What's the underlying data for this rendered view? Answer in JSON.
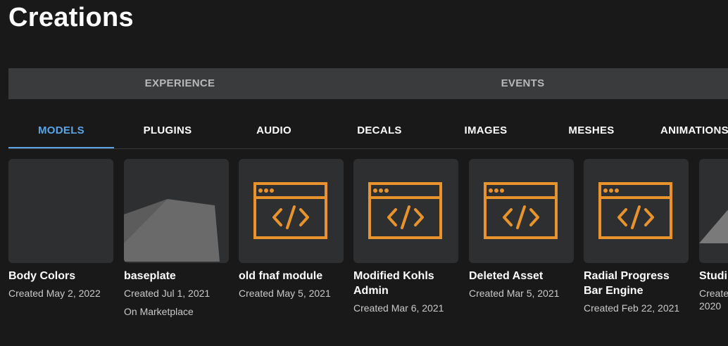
{
  "page": {
    "title": "Creations"
  },
  "primary_tabs": [
    {
      "label": "EXPERIENCE"
    },
    {
      "label": "EVENTS"
    }
  ],
  "secondary_tabs": [
    {
      "label": "MODELS",
      "active": true
    },
    {
      "label": "PLUGINS"
    },
    {
      "label": "AUDIO"
    },
    {
      "label": "DECALS"
    },
    {
      "label": "IMAGES"
    },
    {
      "label": "MESHES"
    },
    {
      "label": "ANIMATIONS"
    }
  ],
  "colors": {
    "accent": "#5aa5e6",
    "script_icon": "#e8932c",
    "background": "#191919",
    "card": "#2e2f31"
  },
  "creations": [
    {
      "title": "Body Colors",
      "created": "Created May 2, 2022",
      "thumbnail": "blank"
    },
    {
      "title": "baseplate",
      "created": "Created Jul 1, 2021",
      "extra": "On Marketplace",
      "thumbnail": "baseplate-render"
    },
    {
      "title": "old fnaf module",
      "created": "Created May 5, 2021",
      "thumbnail": "code-window-icon"
    },
    {
      "title": "Modified Kohls Admin",
      "created": "Created Mar 6, 2021",
      "thumbnail": "code-window-icon"
    },
    {
      "title": "Deleted Asset",
      "created": "Created Mar 5, 2021",
      "thumbnail": "code-window-icon"
    },
    {
      "title": "Radial Progress Bar Engine",
      "created": "Created Feb 22, 2021",
      "thumbnail": "code-window-icon"
    },
    {
      "title": "Studi",
      "created": "Create 2020",
      "thumbnail": "partial"
    }
  ]
}
